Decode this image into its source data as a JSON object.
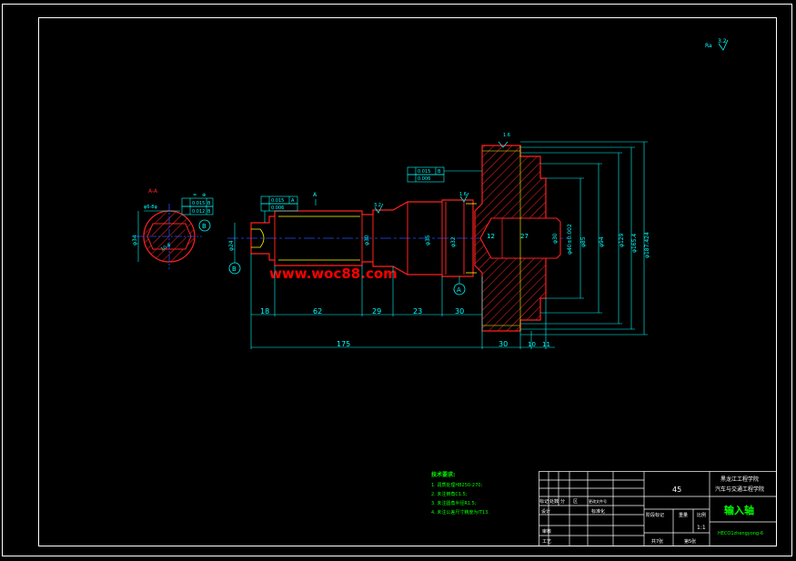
{
  "drawing": {
    "section_label": "A-A",
    "view_marker": "A",
    "watermark": "www.woc88.com",
    "keyway_label": "φ6-8φ",
    "datum_label": "B",
    "section_dia": "φ34",
    "key_width": "10-8",
    "tol_frame_1": [
      "0.015",
      "B"
    ],
    "tol_frame_2": [
      "0.012",
      "B"
    ],
    "tol_frame_3": [
      "0.015",
      "A"
    ],
    "tol_frame_4": [
      "0.006",
      ""
    ],
    "tol_frame_5": [
      "0.015",
      "B"
    ],
    "tol_frame_6": [
      "0.006",
      ""
    ],
    "roughness_a": "3.2",
    "roughness_b": "1.6",
    "roughness_c": "1.6",
    "roughness_corner_prefix": "Ra",
    "roughness_corner": "3.2",
    "datum_a": "A",
    "dim_left_small": "φ24",
    "dim_bore_12": "12",
    "dim_bore_27": "27",
    "dim_phi30": "φ30",
    "dim_phi35": "φ35",
    "dim_phi40": "φ40±0.002",
    "dim_phi85": "φ85",
    "dim_phi94": "φ94",
    "dim_phi129": "φ129",
    "dim_phi165": "φ165.4",
    "dim_phi187": "φ187.424",
    "dim_phi32": "φ32",
    "dim_lengths": [
      "18",
      "62",
      "29",
      "23",
      "30"
    ],
    "dim_total": "175",
    "dim_right": [
      "30",
      "10",
      "11"
    ]
  },
  "notes": {
    "title": "技术要求:",
    "items": [
      "1. 调质处理HB250-270;",
      "2. 未注倒角C1.5;",
      "3. 未注圆角半径R1.5;",
      "4. 未注公差尺寸精度为IT13."
    ]
  },
  "title_block": {
    "material": "45",
    "school_line1": "黑龙江工程学院",
    "school_line2": "汽车与交通工程学院",
    "part_name": "输入轴",
    "drawing_no": "HECO1zhengyong-6",
    "rev_row": [
      "标记",
      "处数",
      "分",
      "区",
      "更改文件号"
    ],
    "design": "设计",
    "standard": "标准化",
    "check": "审核",
    "process": "工艺",
    "stage_header": [
      "阶段标记",
      "重量",
      "比例"
    ],
    "scale": "1:1",
    "sheets_total": "共7张",
    "sheet_no": "第5张"
  },
  "colors": {
    "border": "#ffffff",
    "outline": "#ff2020",
    "dimension": "#00ffff",
    "centerline": "#2050ff",
    "hatch": "#ff2020",
    "notes": "#00ff00",
    "part_name": "#00ff00",
    "watermark": "#ff0000"
  }
}
